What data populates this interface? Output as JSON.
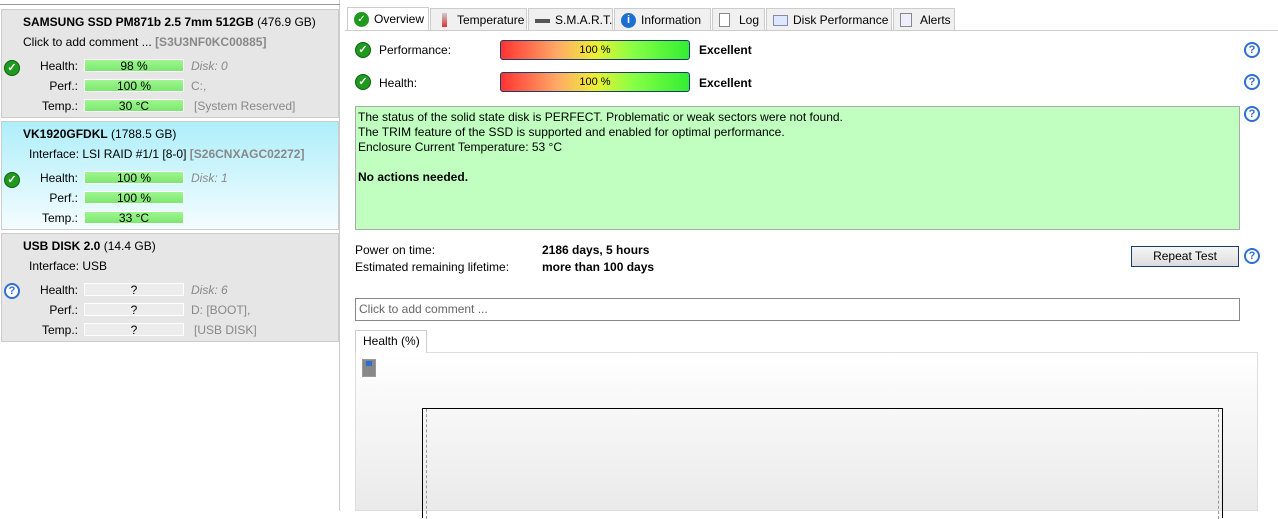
{
  "disks": [
    {
      "name": "SAMSUNG SSD PM871b 2.5 7mm 512GB",
      "size": "(476.9 GB)",
      "subline": "Click to add comment ...",
      "serial": "[S3U3NF0KC00885]",
      "status": "ok",
      "health": "98 %",
      "perf": "100 %",
      "temp": "30 °C",
      "extra1": "Disk: 0",
      "extra2": "C:,",
      "extra3": "[System Reserved]"
    },
    {
      "name": "VK1920GFDKL",
      "size": "(1788.5 GB)",
      "subline": "Interface:  LSI  RAID #1/1 [8-0]",
      "serial": "[S26CNXAGC02272]",
      "status": "ok",
      "health": "100 %",
      "perf": "100 %",
      "temp": "33 °C",
      "extra1": "Disk: 1",
      "extra2": "",
      "extra3": ""
    },
    {
      "name": "USB DISK 2.0",
      "size": "(14.4 GB)",
      "subline": "Interface:  USB",
      "serial": "",
      "status": "unknown",
      "health": "?",
      "perf": "?",
      "temp": "?",
      "extra1": "Disk: 6",
      "extra2": "D: [BOOT],",
      "extra3": "[USB DISK]"
    }
  ],
  "labels": {
    "health": "Health:",
    "perf": "Perf.:",
    "temp": "Temp.:"
  },
  "tabs": [
    {
      "label": "Overview",
      "icon": "check-icon"
    },
    {
      "label": "Temperature",
      "icon": "thermometer-icon"
    },
    {
      "label": "S.M.A.R.T.",
      "icon": "drive-icon"
    },
    {
      "label": "Information",
      "icon": "info-icon"
    },
    {
      "label": "Log",
      "icon": "document-icon"
    },
    {
      "label": "Disk Performance",
      "icon": "chart-icon"
    },
    {
      "label": "Alerts",
      "icon": "alerts-icon"
    }
  ],
  "overview": {
    "performance": {
      "label": "Performance:",
      "value": "100 %",
      "percent": 100,
      "rating": "Excellent"
    },
    "health": {
      "label": "Health:",
      "value": "100 %",
      "percent": 100,
      "rating": "Excellent"
    },
    "status_lines": [
      "The status of the solid state disk is PERFECT. Problematic or weak sectors were not found.",
      "The TRIM feature of the SSD is supported and enabled for optimal performance.",
      "Enclosure Current Temperature: 53 °C"
    ],
    "status_bold": "No actions needed.",
    "power_on_label": "Power on time:",
    "power_on_value": "2186 days, 5 hours",
    "lifetime_label": "Estimated remaining lifetime:",
    "lifetime_value": "more than 100 days",
    "repeat_test": "Repeat Test",
    "comment_placeholder": "Click to add comment ...",
    "chart_tab": "Health (%)"
  },
  "colors": {
    "status_bg": "#c0ffc0",
    "selected_card": "#aeeefa",
    "ok": "#1f9a1f"
  }
}
